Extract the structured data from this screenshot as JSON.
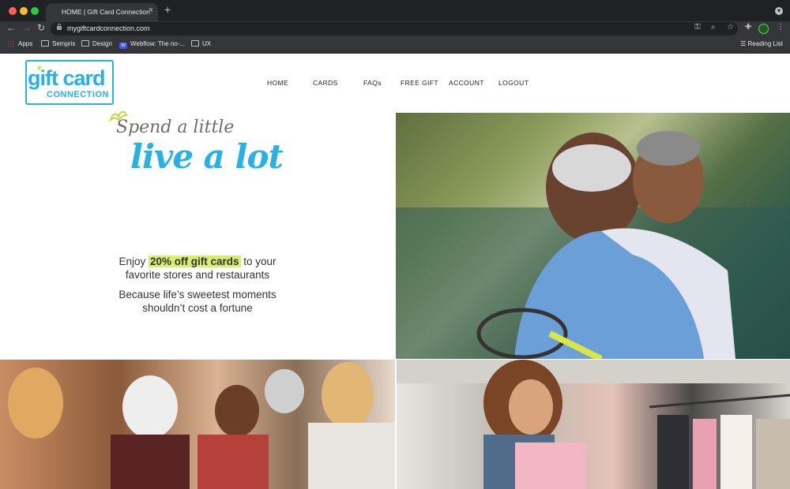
{
  "browser": {
    "tab_title": "HOME | Gift Card Connection",
    "tab_close": "×",
    "new_tab": "+",
    "url": "mygiftcardconnection.com",
    "bookmarks": [
      {
        "label": "Apps",
        "icon": "apps-grid-icon"
      },
      {
        "label": "Sempris",
        "icon": "folder-icon"
      },
      {
        "label": "Design",
        "icon": "folder-icon"
      },
      {
        "label": "Webflow: The no-...",
        "icon": "webflow-icon"
      },
      {
        "label": "UX",
        "icon": "folder-icon"
      }
    ],
    "reading_list": "Reading List",
    "webflow_glyph": "W"
  },
  "site": {
    "logo": {
      "main": "gift card",
      "sub": "CONNECTION",
      "tm": "™"
    },
    "nav": [
      "HOME",
      "CARDS",
      "FAQs",
      "FREE GIFT",
      "ACCOUNT",
      "LOGOUT"
    ],
    "hero": {
      "script_line1": "Spend a little",
      "script_line2": "live a lot",
      "tagline1_prefix": "Enjoy ",
      "tagline1_highlight": "20% off gift cards",
      "tagline1_suffix": " to your",
      "tagline1_line2": "favorite stores and restaurants",
      "tagline2_line1": "Because life’s sweetest moments",
      "tagline2_line2": "shouldn’t cost a fortune"
    }
  },
  "colors": {
    "brand_blue": "#27b1e6",
    "brand_green": "#c6da3e",
    "highlight": "#d7ee6e",
    "chrome_dark": "#202124"
  }
}
